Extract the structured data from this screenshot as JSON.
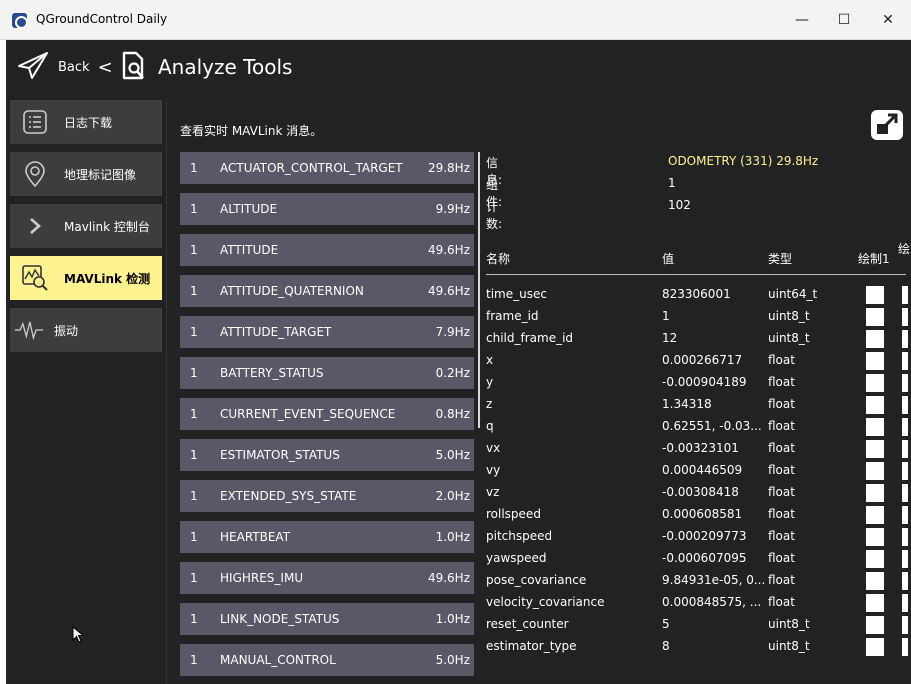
{
  "window": {
    "title": "QGroundControl Daily",
    "minimize": "—",
    "maximize": "☐",
    "close": "✕"
  },
  "toolbar": {
    "back_label": "Back",
    "back_chevron": "<",
    "page_title": "Analyze Tools"
  },
  "sidebar": {
    "items": [
      {
        "label": "日志下载",
        "icon": "log-list-icon",
        "active": false
      },
      {
        "label": "地理标记图像",
        "icon": "geotag-pin-icon",
        "active": false
      },
      {
        "label": "Mavlink 控制台",
        "icon": "chevron-right-icon",
        "active": false
      },
      {
        "label": "MAVLink 检测",
        "icon": "chart-magnifier-icon",
        "active": true
      },
      {
        "label": "振动",
        "icon": "vibration-wave-icon",
        "active": false
      }
    ]
  },
  "inspector": {
    "description": "查看实时 MAVLink 消息。",
    "messages": [
      {
        "comp": "1",
        "name": "ACTUATOR_CONTROL_TARGET",
        "rate": "29.8Hz"
      },
      {
        "comp": "1",
        "name": "ALTITUDE",
        "rate": "9.9Hz"
      },
      {
        "comp": "1",
        "name": "ATTITUDE",
        "rate": "49.6Hz"
      },
      {
        "comp": "1",
        "name": "ATTITUDE_QUATERNION",
        "rate": "49.6Hz"
      },
      {
        "comp": "1",
        "name": "ATTITUDE_TARGET",
        "rate": "7.9Hz"
      },
      {
        "comp": "1",
        "name": "BATTERY_STATUS",
        "rate": "0.2Hz"
      },
      {
        "comp": "1",
        "name": "CURRENT_EVENT_SEQUENCE",
        "rate": "0.8Hz"
      },
      {
        "comp": "1",
        "name": "ESTIMATOR_STATUS",
        "rate": "5.0Hz"
      },
      {
        "comp": "1",
        "name": "EXTENDED_SYS_STATE",
        "rate": "2.0Hz"
      },
      {
        "comp": "1",
        "name": "HEARTBEAT",
        "rate": "1.0Hz"
      },
      {
        "comp": "1",
        "name": "HIGHRES_IMU",
        "rate": "49.6Hz"
      },
      {
        "comp": "1",
        "name": "LINK_NODE_STATUS",
        "rate": "1.0Hz"
      },
      {
        "comp": "1",
        "name": "MANUAL_CONTROL",
        "rate": "5.0Hz"
      }
    ],
    "info": {
      "message_label": "信息:",
      "message_value": "ODOMETRY (331) 29.8Hz",
      "component_label": "组件:",
      "component_value": "1",
      "count_label": "计数:",
      "count_value": "102"
    },
    "columns": {
      "name": "名称",
      "value": "值",
      "type": "类型",
      "plot1": "绘制1",
      "plot2": "绘"
    },
    "fields": [
      {
        "name": "time_usec",
        "value": "823306001",
        "type": "uint64_t"
      },
      {
        "name": "frame_id",
        "value": "1",
        "type": "uint8_t"
      },
      {
        "name": "child_frame_id",
        "value": "12",
        "type": "uint8_t"
      },
      {
        "name": "x",
        "value": "0.000266717",
        "type": "float"
      },
      {
        "name": "y",
        "value": "-0.000904189",
        "type": "float"
      },
      {
        "name": "z",
        "value": "1.34318",
        "type": "float"
      },
      {
        "name": "q",
        "value": "0.62551, -0.03...",
        "type": "float"
      },
      {
        "name": "vx",
        "value": "-0.00323101",
        "type": "float"
      },
      {
        "name": "vy",
        "value": "0.000446509",
        "type": "float"
      },
      {
        "name": "vz",
        "value": "-0.00308418",
        "type": "float"
      },
      {
        "name": "rollspeed",
        "value": "0.000608581",
        "type": "float"
      },
      {
        "name": "pitchspeed",
        "value": "-0.000209773",
        "type": "float"
      },
      {
        "name": "yawspeed",
        "value": "-0.000607095",
        "type": "float"
      },
      {
        "name": "pose_covariance",
        "value": "9.84931e-05, 0...",
        "type": "float"
      },
      {
        "name": "velocity_covariance",
        "value": "0.000848575, ...",
        "type": "float"
      },
      {
        "name": "reset_counter",
        "value": "5",
        "type": "uint8_t"
      },
      {
        "name": "estimator_type",
        "value": "8",
        "type": "uint8_t"
      }
    ]
  },
  "colors": {
    "background": "#222222",
    "sidebar_button": "#3d3d3d",
    "active_accent": "#fff291",
    "message_item": "#595866"
  }
}
